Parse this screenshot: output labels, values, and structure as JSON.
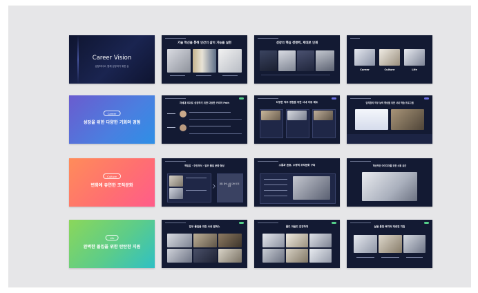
{
  "rows": [
    {
      "cover": {
        "title": "Career Vision",
        "subtitle": "성장하다고, 함께 성장하기 위한 승"
      },
      "s2_title": "기술 혁신을 통해 인간의 삶이 가능을 실현",
      "s3_title": "성장의 핵심 경쟁력, 제대로 인재",
      "s4_labels": [
        "Career",
        "Culture",
        "Life"
      ]
    },
    {
      "section": {
        "badge": "Career",
        "title": "성장을 위한 다양한 기회와 경험"
      },
      "s2_title": "차세대 리더로 성장하기 위한 다양한 커리어 Path",
      "s3_title": "다양한 직무 경험을 위한 사내 이동 제도",
      "s4_title": "임직원의 직무 능력 향상을 위한 사내 학습 프로그램",
      "s4_sub": "사내 벤처 제도(C-lab)"
    },
    {
      "section": {
        "badge": "Culture",
        "title": "변화에 유연한 조직문화"
      },
      "s2_title": "책임감 · 주인의식 · 업무 몰입 문화 형성",
      "s2_right": "자율, 창의, 신뢰 기반 조직 문화",
      "s3_title": "소통과 존중, 수평적 조직문화 구축",
      "s4_title": "혁신적인 아이디어를 위한 소통 공간"
    },
    {
      "section": {
        "badge": "Life",
        "title": "완벽한 몰입을 위한 탄탄한 지원"
      },
      "s2_title": "업무 몰입을 위한 사내 캠퍼스",
      "s3_title": "몸도 마음도 건강하게",
      "s4_title": "삶을 통한 복지와 재충전 지원"
    }
  ],
  "colors": {
    "canvas": "#e6e6e8",
    "dark_slide": "#131a33",
    "career_gradient": [
      "#6a5ccf",
      "#2e8fe6"
    ],
    "culture_gradient": [
      "#ff8c5a",
      "#ff5c8a"
    ],
    "life_gradient": [
      "#8bd75a",
      "#2fc0c4"
    ],
    "accent_green": "#55d08a"
  }
}
